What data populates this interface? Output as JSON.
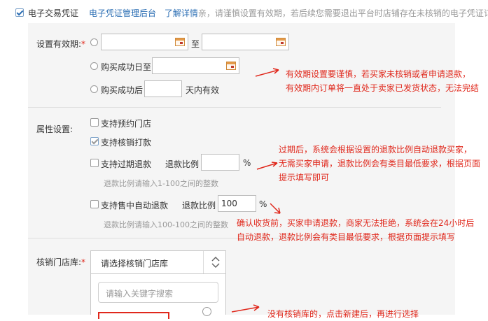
{
  "header": {
    "checkbox_label": "电子交易凭证",
    "link_admin": "电子凭证管理后台",
    "link_more": "了解详情",
    "desc": "亲，请谨慎设置有效期，若后续您需要退出平台时店铺存在未核销的电子凭证订单"
  },
  "validity": {
    "label": "设置有效期:",
    "required_mark": "*",
    "range_to": "至",
    "option_until": "购买成功日至",
    "option_after": "购买成功后",
    "days_suffix": "天内有效"
  },
  "attributes": {
    "label": "属性设置:",
    "opt_store": "支持预约门店",
    "opt_verify": "支持核销打款",
    "opt_expire_refund": "支持过期退款",
    "refund_ratio_label": "退款比例",
    "percent": "%",
    "hint_1": "退款比例请输入1-100之间的整数",
    "opt_auto_refund": "支持售中自动退款",
    "refund_ratio_label_2": "退款比例",
    "refund_ratio_value_2": "100",
    "percent_2": "%",
    "hint_2": "退款比例请输入100-100之间的整数"
  },
  "store": {
    "label": "核销门店库:",
    "required_mark": "*",
    "select_placeholder": "请选择核销门店库",
    "search_placeholder": "请输入关键字搜索"
  },
  "notes": {
    "note1_line1": "有效期设置要谨慎，若买家未核销或者申请退款，",
    "note1_line2": "有效期内订单将一直处于卖家已发货状态，无法完结",
    "note2_line1": "过期后，系统会根据设置的退款比例自动退款买家，",
    "note2_line2": "无需买家申请，退款比例会有类目最低要求，根据页面",
    "note2_line3": "提示填写即可",
    "note3_line1": "确认收货前，买家申请退款，商家无法拒绝，系统会在24小时后",
    "note3_line2": "自动退款，退款比例会有类目最低要求，根据页面提示填写",
    "note4": "没有核销库的，点击新建后，再进行选择"
  },
  "colors": {
    "accent": "#2a6db3",
    "annotation": "#e0281c"
  },
  "state": {
    "voucher_enabled": true,
    "support_verify_payment": true,
    "support_store": false,
    "support_expire_refund": false,
    "support_auto_refund": false
  }
}
